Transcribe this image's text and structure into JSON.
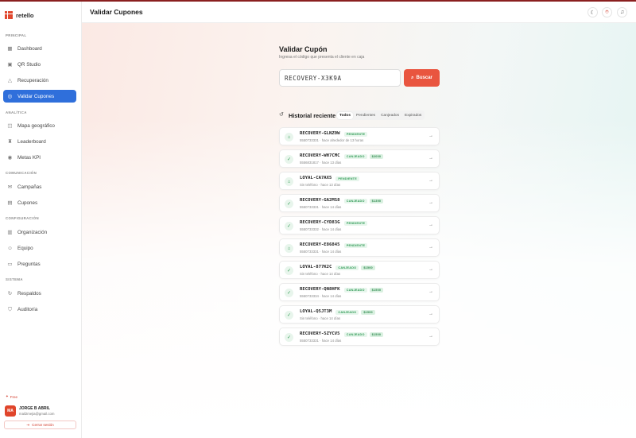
{
  "brand": {
    "name": "retello"
  },
  "header": {
    "title": "Validar Cupones",
    "theme_icon": "moon-icon",
    "fingerprint_icon": "fingerprint-icon",
    "bell_icon": "bell-icon"
  },
  "sidebar": {
    "sections": [
      {
        "title": "PRINCIPAL",
        "items": [
          {
            "label": "Dashboard",
            "icon": "grid-icon"
          },
          {
            "label": "QR Studio",
            "icon": "qr-icon"
          },
          {
            "label": "Recuperación",
            "icon": "warning-icon"
          },
          {
            "label": "Validar Cupones",
            "icon": "check-circle-icon",
            "active": true
          }
        ]
      },
      {
        "title": "ANALÍTICA",
        "items": [
          {
            "label": "Mapa geográfico",
            "icon": "map-icon"
          },
          {
            "label": "Leaderboard",
            "icon": "trophy-icon"
          },
          {
            "label": "Metas KPI",
            "icon": "target-icon"
          }
        ]
      },
      {
        "title": "COMUNICACIÓN",
        "items": [
          {
            "label": "Campañas",
            "icon": "mail-icon"
          },
          {
            "label": "Cupones",
            "icon": "gift-icon"
          }
        ]
      },
      {
        "title": "CONFIGURACIÓN",
        "items": [
          {
            "label": "Organización",
            "icon": "building-icon"
          },
          {
            "label": "Equipo",
            "icon": "users-icon"
          },
          {
            "label": "Preguntas",
            "icon": "chat-icon"
          }
        ]
      },
      {
        "title": "SISTEMA",
        "items": [
          {
            "label": "Respaldos",
            "icon": "refresh-icon"
          },
          {
            "label": "Auditoría",
            "icon": "shield-icon"
          }
        ]
      }
    ],
    "plan": "Free",
    "user": {
      "initials": "MA",
      "name": "JORGE B ABRIL",
      "email": "mail2mejia@gmail.com"
    },
    "logout_label": "Cerrar sesión"
  },
  "validate": {
    "title": "Validar Cupón",
    "subtitle": "Ingresa el código que presenta el cliente en caja",
    "input_value": "RECOVERY-X3K9A",
    "search_label": "Buscar"
  },
  "history": {
    "title": "Historial reciente",
    "tabs": [
      {
        "label": "Todos",
        "active": true
      },
      {
        "label": "Pendientes"
      },
      {
        "label": "Canjeados"
      },
      {
        "label": "Expirados"
      }
    ],
    "items": [
      {
        "code": "RECOVERY-GLNZ0W",
        "status": "PENDIENTE",
        "amount": "",
        "meta": "5550733331 · hace alrededor de 13 horas",
        "icon": "tag-icon"
      },
      {
        "code": "RECOVERY-WH7CMC",
        "status": "CANJEADO",
        "amount": "$2000",
        "meta": "5556831817 · hace 13 días",
        "icon": "check-circle-icon"
      },
      {
        "code": "LOYAL-CA7AX5",
        "status": "PENDIENTE",
        "amount": "",
        "meta": "Sin teléfono · hace 13 días",
        "icon": "tag-icon"
      },
      {
        "code": "RECOVERY-GA2MS8",
        "status": "CANJEADO",
        "amount": "$1390",
        "meta": "5550733331 · hace 14 días",
        "icon": "check-circle-icon"
      },
      {
        "code": "RECOVERY-CYD83G",
        "status": "PENDIENTE",
        "amount": "",
        "meta": "5550733332 · hace 14 días",
        "icon": "check-circle-icon"
      },
      {
        "code": "RECOVERY-E86845",
        "status": "PENDIENTE",
        "amount": "",
        "meta": "5550733331 · hace 14 días",
        "icon": "tag-icon"
      },
      {
        "code": "LOYAL-877K2C",
        "status": "CANJEADO",
        "amount": "$1500",
        "meta": "Sin teléfono · hace 14 días",
        "icon": "check-circle-icon"
      },
      {
        "code": "RECOVERY-QN8HFK",
        "status": "CANJEADO",
        "amount": "$1500",
        "meta": "5550733334 · hace 14 días",
        "icon": "check-circle-icon"
      },
      {
        "code": "LOYAL-Q5JT3M",
        "status": "CANJEADO",
        "amount": "$1500",
        "meta": "Sin teléfono · hace 14 días",
        "icon": "check-circle-icon"
      },
      {
        "code": "RECOVERY-5ZYCV5",
        "status": "CANJEADO",
        "amount": "$1500",
        "meta": "5550733331 · hace 14 días",
        "icon": "check-circle-icon"
      }
    ]
  }
}
